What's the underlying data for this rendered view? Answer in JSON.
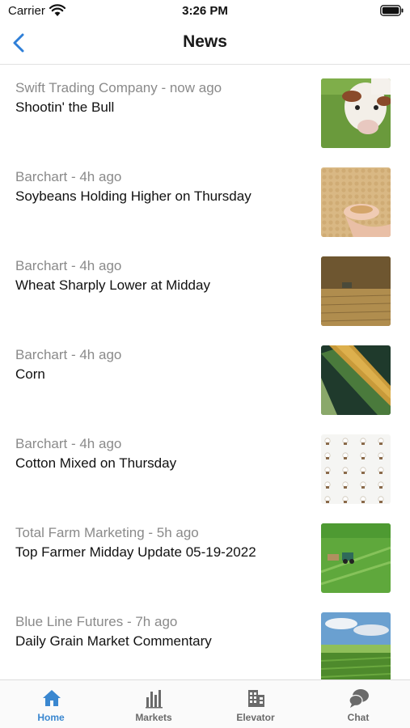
{
  "status_bar": {
    "carrier": "Carrier",
    "time": "3:26 PM"
  },
  "nav": {
    "title": "News",
    "back_icon": "chevron-left-icon"
  },
  "news": [
    {
      "meta": "Swift Trading Company - now ago",
      "headline": "Shootin' the Bull",
      "thumb": "cow-photo"
    },
    {
      "meta": "Barchart - 4h ago",
      "headline": "Soybeans Holding Higher on Thursday",
      "thumb": "soybeans-photo"
    },
    {
      "meta": "Barchart - 4h ago",
      "headline": "Wheat Sharply Lower at Midday",
      "thumb": "wheat-field-photo"
    },
    {
      "meta": "Barchart - 4h ago",
      "headline": "Corn",
      "thumb": "corn-cob-photo"
    },
    {
      "meta": "Barchart - 4h ago",
      "headline": "Cotton Mixed on Thursday",
      "thumb": "cotton-bolls-photo"
    },
    {
      "meta": "Total Farm Marketing - 5h ago",
      "headline": "Top Farmer Midday Update 05-19-2022",
      "thumb": "tractor-field-photo"
    },
    {
      "meta": "Blue Line Futures - 7h ago",
      "headline": "Daily Grain Market Commentary",
      "thumb": "cornfield-sky-photo"
    }
  ],
  "tabs": [
    {
      "label": "Home",
      "icon": "home-icon",
      "active": true
    },
    {
      "label": "Markets",
      "icon": "bar-chart-icon",
      "active": false
    },
    {
      "label": "Elevator",
      "icon": "building-icon",
      "active": false
    },
    {
      "label": "Chat",
      "icon": "chat-bubbles-icon",
      "active": false
    }
  ],
  "colors": {
    "accent": "#3a87d0",
    "meta_text": "#8a8a8a",
    "back_button": "#2f7fd8"
  }
}
